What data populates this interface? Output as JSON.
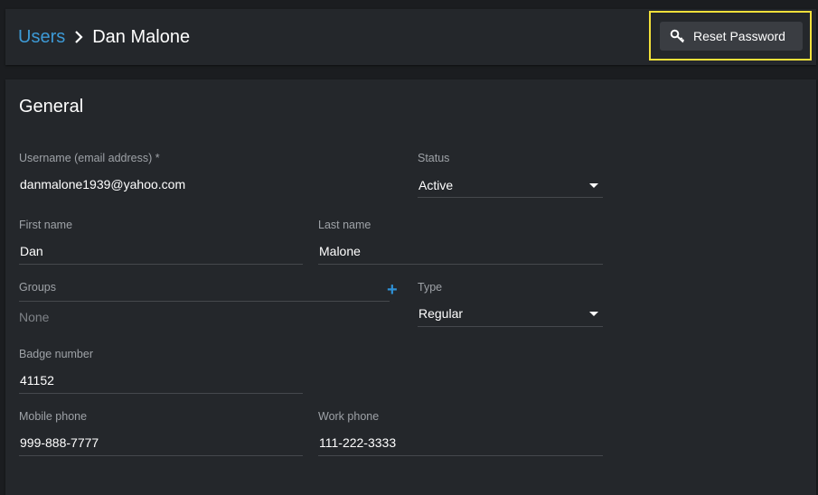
{
  "breadcrumb": {
    "parent": "Users",
    "current": "Dan Malone"
  },
  "header": {
    "reset_password_label": "Reset Password"
  },
  "general": {
    "title": "General",
    "username_label": "Username (email address) *",
    "username_value": "danmalone1939@yahoo.com",
    "status_label": "Status",
    "status_value": "Active",
    "first_name_label": "First name",
    "first_name_value": "Dan",
    "last_name_label": "Last name",
    "last_name_value": "Malone",
    "groups_label": "Groups",
    "groups_value": "None",
    "type_label": "Type",
    "type_value": "Regular",
    "badge_label": "Badge number",
    "badge_value": "41152",
    "mobile_label": "Mobile phone",
    "mobile_value": "999-888-7777",
    "work_label": "Work phone",
    "work_value": "111-222-3333"
  },
  "icons": {
    "breadcrumb_separator": "chevron-right-icon",
    "reset_password": "key-icon",
    "groups_add": "plus-icon",
    "select": "caret-down-icon"
  },
  "colors": {
    "accent": "#3d9ad6",
    "highlight": "#f2e03a",
    "panel": "#24272b",
    "background": "#1b1d20"
  }
}
